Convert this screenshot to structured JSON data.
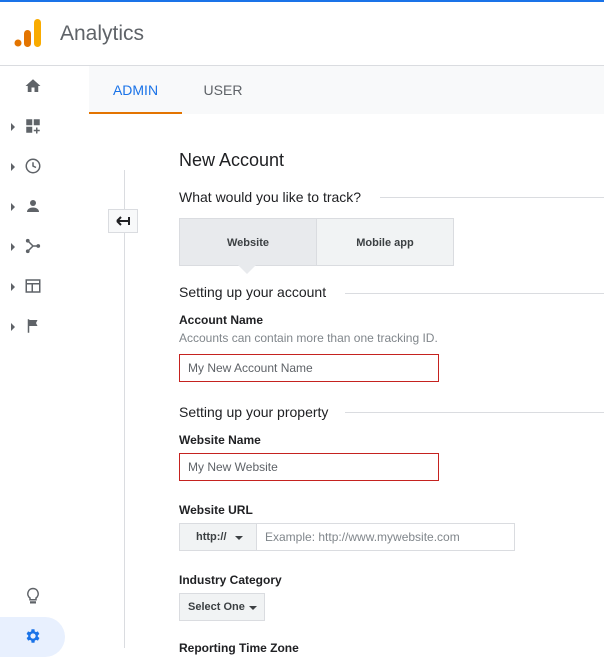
{
  "colors": {
    "accent_blue": "#1a73e8",
    "tab_underline": "#e37400",
    "error_red": "#c5221f",
    "logo_orange": "#f9ab00",
    "logo_dark_orange": "#e37400"
  },
  "header": {
    "app_title": "Analytics",
    "logo_icon": "analytics-logo-icon"
  },
  "sidebar": {
    "items": [
      {
        "icon": "home-icon"
      },
      {
        "icon": "dashboard-icon"
      },
      {
        "icon": "clock-icon"
      },
      {
        "icon": "person-icon"
      },
      {
        "icon": "acquisition-icon"
      },
      {
        "icon": "behavior-icon"
      },
      {
        "icon": "flag-icon"
      }
    ],
    "bottom": [
      {
        "icon": "lightbulb-icon"
      },
      {
        "icon": "gear-icon"
      }
    ]
  },
  "tabs": [
    {
      "label": "ADMIN"
    },
    {
      "label": "USER"
    }
  ],
  "form": {
    "title": "New Account",
    "track_question": "What would you like to track?",
    "track_options": [
      "Website",
      "Mobile app"
    ],
    "account_section": "Setting up your account",
    "account_name_label": "Account Name",
    "account_name_help": "Accounts can contain more than one tracking ID.",
    "account_name_placeholder": "My New Account Name",
    "property_section": "Setting up your property",
    "website_name_label": "Website Name",
    "website_name_placeholder": "My New Website",
    "website_url_label": "Website URL",
    "url_protocol": "http://",
    "url_placeholder": "Example: http://www.mywebsite.com",
    "industry_label": "Industry Category",
    "industry_value": "Select One",
    "timezone_label": "Reporting Time Zone"
  }
}
